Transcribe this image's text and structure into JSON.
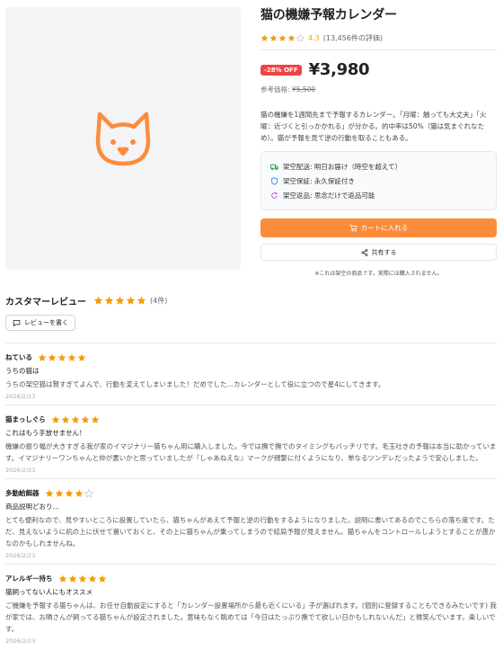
{
  "product": {
    "title": "猫の機嫌予報カレンダー",
    "rating": "4.3",
    "rating_count": "(13,456件の評価)",
    "rating_stars": 4,
    "off_badge": "-28% OFF",
    "price": "¥3,980",
    "ref_label": "参考価格: ",
    "ref_price": "¥5,500",
    "description": "猫の機嫌を1週間先まで予報するカレンダー。「月曜：触っても大丈夫」「火曜：近づくと引っかかれる」が分かる。的中率は50%（猫は気まぐれなため）。猫が予報を見て逆の行動を取ることもある。",
    "features": [
      {
        "icon": "truck-icon",
        "text": "架空配送: 明日お届け（時空を超えて）"
      },
      {
        "icon": "shield-icon",
        "text": "架空保証: 永久保証付き"
      },
      {
        "icon": "refresh-icon",
        "text": "架空返品: 思念だけで返品可能"
      }
    ],
    "cart_label": "カートに入れる",
    "share_label": "共有する",
    "note": "※これは架空の商品です。実際には購入されません。"
  },
  "colors": {
    "accent": "#fb8c3c",
    "star": "#f59e0b",
    "badge": "#ef4444"
  },
  "reviews_section": {
    "title": "カスタマーレビュー",
    "count": "(4件)",
    "stars": 5,
    "write_label": "レビューを書く"
  },
  "reviews": [
    {
      "author": "ねている",
      "stars": 5,
      "title": "うちの猫は",
      "body": "うちの架空猫は賢すぎてよんで、行動を変えてしまいました！だめでした…カレンダーとして役に立つので星4にしてきます。",
      "date": "2026/2/23"
    },
    {
      "author": "猫まっしぐら",
      "stars": 5,
      "title": "これはもう手放せません！",
      "body": "機嫌の振り幅が大きすぎる我が家のイマジナリー猫ちゃん用に購入しました。今では撫で撫でのタイミングもバッチリです。毛玉吐きの予報は本当に助かっています。イマジナリーワンちゃんと仲が悪いかと思っていましたが『しゃあねえな』マークが頻繁に付くようになり、単なるツンデレだったようで安心しました。",
      "date": "2026/2/23"
    },
    {
      "author": "多動給餌器",
      "stars": 4,
      "title": "商品説明どおり…",
      "body": "とても便利なので、見やすいところに設置していたら、猫ちゃんがあえて予報と逆の行動をするようになりました。説明に書いてあるのでこちらの落ち度です。ただ、見えないように机の上に伏せて置いておくと、その上に猫ちゃんが乗ってしまうので結局予報が見えません。猫ちゃんをコントロールしようとすることが愚かなのかもしれませんね。",
      "date": "2026/2/23"
    },
    {
      "author": "アレルギー持ち",
      "stars": 5,
      "title": "猫飼ってない人にもオススメ",
      "body": "ご機嫌を予報する猫ちゃんは、お任せ自動設定にすると「カレンダー設置場所から最も近くにいる」子が選ばれます。(個別に登録することもできるみたいです) 我が家では、お隣さんが飼ってる猫ちゃんが設定されました。意味もなく眺めては「今日はたっぷり撫でて欲しい日かもしれないんだ」と微笑んでいます。楽しいです。",
      "date": "2026/2/23"
    }
  ]
}
